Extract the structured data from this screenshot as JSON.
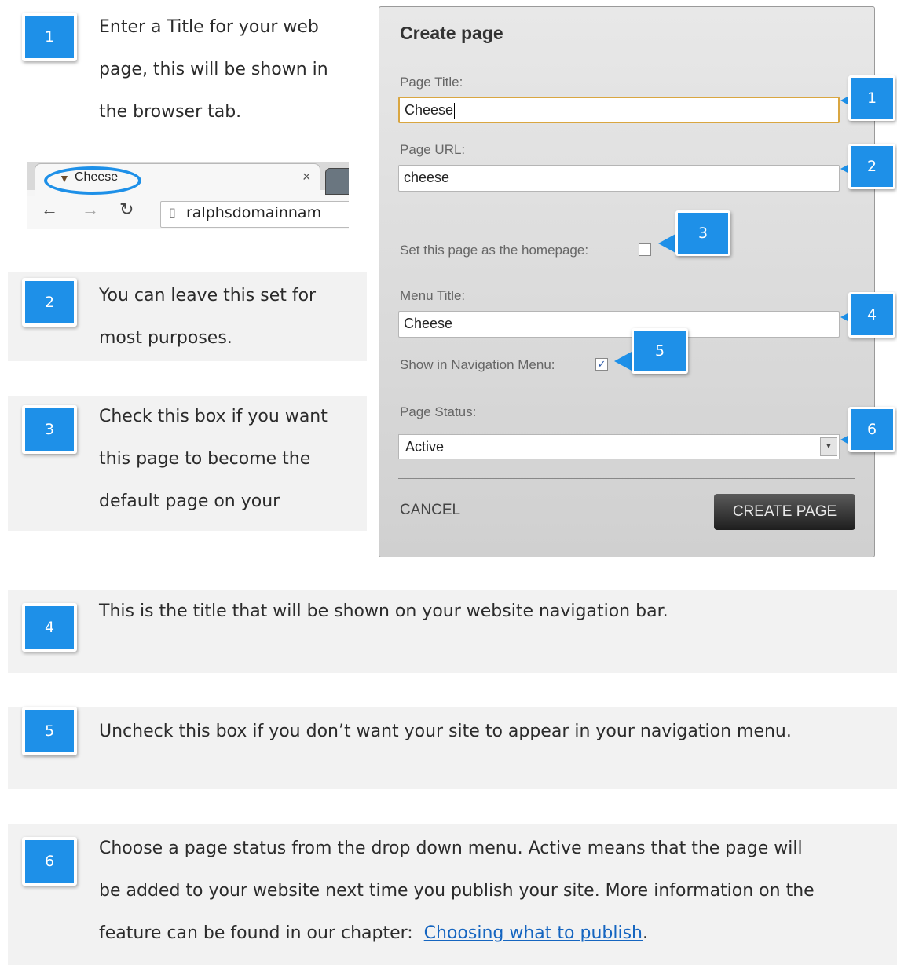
{
  "notes": [
    {
      "num": "1",
      "lines": [
        "Enter a Title for your web",
        "page, this will be shown in",
        "the browser tab."
      ]
    },
    {
      "num": "2",
      "lines": [
        "You can leave this set for",
        "most purposes."
      ]
    },
    {
      "num": "3",
      "lines": [
        "Check this box if you want",
        "this page to become the",
        "default page on your"
      ]
    },
    {
      "num": "4",
      "lines": [
        "This is the title that will be shown on your website navigation bar."
      ]
    },
    {
      "num": "5",
      "lines": [
        "Uncheck this box if you don’t want your site to appear in your navigation menu."
      ]
    },
    {
      "num": "6",
      "lines": [
        "Choose a page status from the drop down menu. Active means that the page will",
        "be added to your website next time you publish your site. More information on the"
      ],
      "line3_prefix": "feature can be found in our chapter:  ",
      "link_text": "Choosing what to publish",
      "line3_suffix": "."
    }
  ],
  "browser": {
    "tab_title": "Cheese",
    "close_glyph": "×",
    "url": "ralphsdomainnam"
  },
  "dialog": {
    "title": "Create page",
    "page_title_label": "Page Title:",
    "page_title_value": "Cheese",
    "page_url_label": "Page URL:",
    "page_url_value": "cheese",
    "homepage_label": "Set this page as the homepage:",
    "homepage_checked": false,
    "menu_title_label": "Menu Title:",
    "menu_title_value": "Cheese",
    "show_nav_label": "Show in Navigation Menu:",
    "show_nav_checked": true,
    "check_glyph": "✓",
    "page_status_label": "Page Status:",
    "page_status_value": "Active",
    "cancel_label": "CANCEL",
    "create_label": "CREATE PAGE"
  },
  "callouts": [
    "1",
    "2",
    "3",
    "4",
    "5",
    "6"
  ],
  "colors": {
    "accent": "#1e90e8",
    "panel": "#f2f2f2",
    "link": "#1565c0",
    "focus": "#d9a641"
  }
}
